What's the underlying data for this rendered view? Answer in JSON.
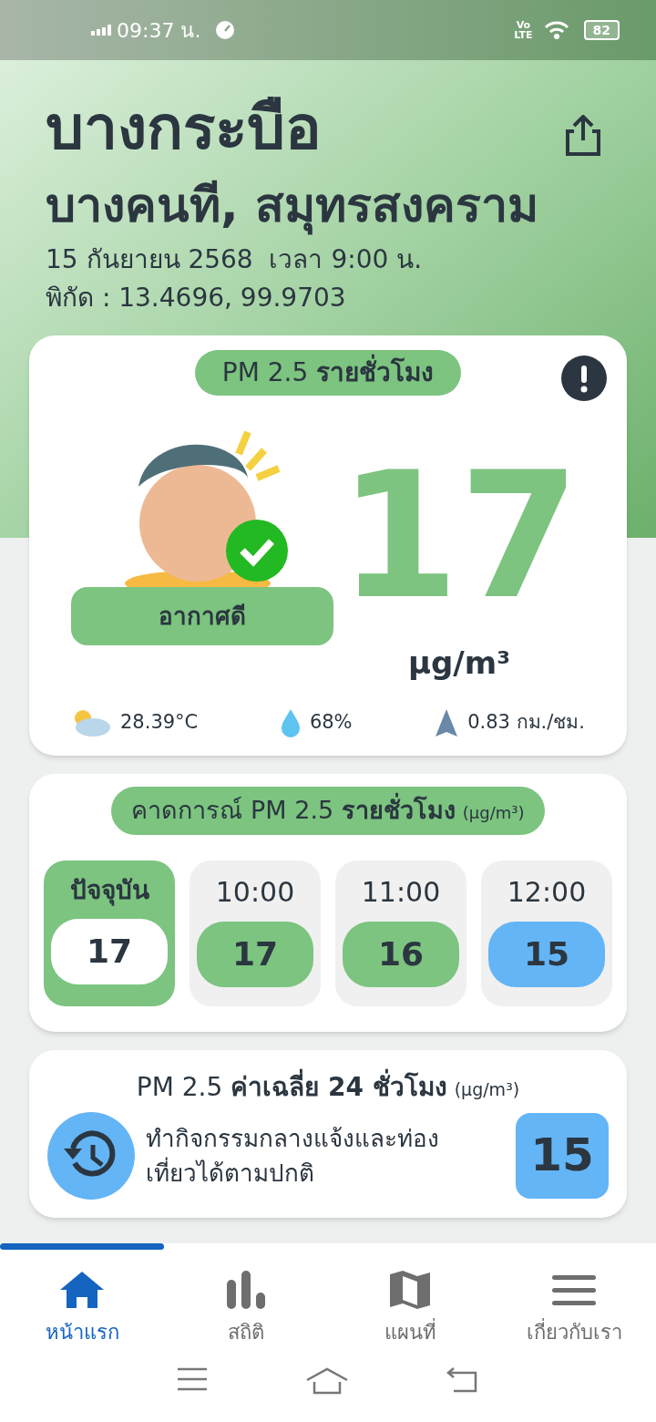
{
  "status_bar": {
    "time": "09:37 น.",
    "network": [
      "Vo",
      "LTE"
    ],
    "battery": "82"
  },
  "location": {
    "title": "บางกระบือ",
    "subtitle": "บางคนที, สมุทรสงคราม",
    "datetime": "15 กันยายน 2568  เวลา 9:00 น.",
    "coords": "พิกัด : 13.4696, 99.9703"
  },
  "current": {
    "heading": "PM 2.5 **รายชั่วโมง**",
    "value": "17",
    "unit": "µg/m³",
    "status": "อากาศดี",
    "color": "#7cc47f",
    "weather": [
      {
        "kind": "temperature",
        "text": "28.39°C"
      },
      {
        "kind": "humidity",
        "text": "68%"
      },
      {
        "kind": "wind",
        "text": "0.83 กม./ชม."
      }
    ]
  },
  "forecast": {
    "heading": "คาดการณ์ PM 2.5 **รายชั่วโมง**",
    "unit": "(µg/m³)",
    "hours": [
      {
        "label": "ปัจจุบัน",
        "value": "17",
        "color": "#7cc47f",
        "selected": true
      },
      {
        "label": "10:00",
        "value": "17",
        "color": "#7cc47f",
        "selected": false
      },
      {
        "label": "11:00",
        "value": "16",
        "color": "#7cc47f",
        "selected": false
      },
      {
        "label": "12:00",
        "value": "15",
        "color": "#64b5f6",
        "selected": false
      }
    ]
  },
  "average": {
    "heading": "PM 2.5 **ค่าเฉลี่ย 24 ชั่วโมง**",
    "unit": "(µg/m³)",
    "advice": "ทำกิจกรรมกลางแจ้งและท่องเที่ยวได้ตามปกติ",
    "value": "15",
    "color": "#64b5f6"
  },
  "nav": [
    {
      "kind": "home",
      "label": "หน้าแรก",
      "selected": true
    },
    {
      "kind": "stats",
      "label": "สถิติ",
      "selected": false
    },
    {
      "kind": "map",
      "label": "แผนที่",
      "selected": false
    },
    {
      "kind": "menu",
      "label": "เกี่ยวกับเรา",
      "selected": false
    }
  ]
}
